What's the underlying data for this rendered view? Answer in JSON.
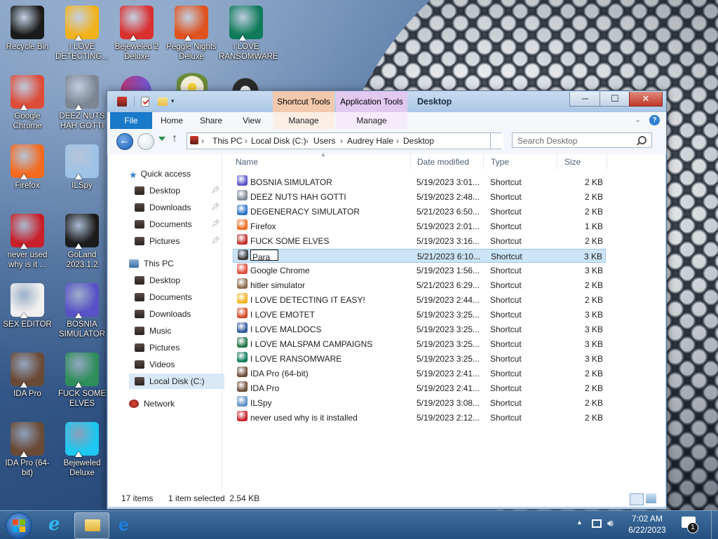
{
  "desktop": {
    "icons": [
      {
        "label": "Recycle Bin",
        "icon": "recycle-bin-icon",
        "color": "#1a1a1a"
      },
      {
        "label": "I LOVE DETECTING...",
        "icon": "die-icon",
        "color": "#f2b21c"
      },
      {
        "label": "Bejeweled 2 Deluxe",
        "icon": "bejeweled-2-icon",
        "color": "#d93030"
      },
      {
        "label": "Peggle Nights Deluxe",
        "icon": "peggle-icon",
        "color": "#e0531f"
      },
      {
        "label": "I LOVE RANSOMWARE",
        "icon": "publisher-icon",
        "color": "#0f7b5a"
      },
      {
        "label": "Google Chrome",
        "icon": "chrome-icon",
        "color": "#dd4b39"
      },
      {
        "label": "DEEZ NUTS HAH GOTTI",
        "icon": "stacked-windows-icon",
        "color": "#7d8794"
      },
      {
        "label": "Firefox",
        "icon": "firefox-icon",
        "color": "#f46a1e"
      },
      {
        "label": "ILSpy",
        "icon": "ilspy-icon",
        "color": "#9fc3e6"
      },
      {
        "label": "never used why is it ...",
        "icon": "devcpp-icon",
        "color": "#c8202a"
      },
      {
        "label": "GoLand 2023.1.2",
        "icon": "goland-icon",
        "color": "#1c1c1c"
      },
      {
        "label": "SEX EDITOR",
        "icon": "hxd-icon",
        "color": "#f0f0f0"
      },
      {
        "label": "BOSNIA SIMULATOR",
        "icon": "spiked-ball-icon",
        "color": "#5a53c8"
      },
      {
        "label": "IDA Pro",
        "icon": "ida-portrait-icon",
        "color": "#6b4a35"
      },
      {
        "label": "FUCK SOME ELVES",
        "icon": "santa-icon",
        "color": "#2f8f5a"
      },
      {
        "label": "IDA Pro (64-bit)",
        "icon": "ida64-portrait-icon",
        "color": "#6b4a35"
      },
      {
        "label": "Bejeweled Deluxe",
        "icon": "diamond-icon",
        "color": "#1ec8f0"
      }
    ],
    "partial_icons": [
      {
        "icon": "chrome-partial-icon",
        "color": "#c8447a"
      },
      {
        "icon": "flower-partial-icon",
        "color": "#e9e1c6"
      },
      {
        "icon": "gear-partial-icon",
        "color": "#2b2b2b"
      }
    ]
  },
  "window": {
    "title": "Desktop",
    "context_tabs": [
      {
        "label": "Shortcut Tools",
        "color": "#f3c9ae"
      },
      {
        "label": "Application Tools",
        "color": "#e1c9f0"
      }
    ],
    "ribbon_tabs": [
      "File",
      "Home",
      "Share",
      "View",
      "Manage",
      "Manage"
    ],
    "controls": {
      "minimize": "─",
      "maximize": "☐",
      "close": "✕"
    },
    "breadcrumbs": [
      "This PC",
      "Local Disk (C:)",
      "Users",
      "Audrey Hale",
      "Desktop"
    ],
    "search_placeholder": "Search Desktop",
    "nav_pane": {
      "quick_access": {
        "label": "Quick access",
        "items": [
          "Desktop",
          "Downloads",
          "Documents",
          "Pictures"
        ]
      },
      "this_pc": {
        "label": "This PC",
        "items": [
          "Desktop",
          "Documents",
          "Downloads",
          "Music",
          "Pictures",
          "Videos",
          "Local Disk (C:)"
        ]
      },
      "network": {
        "label": "Network"
      }
    },
    "columns": [
      "Name",
      "Date modified",
      "Type",
      "Size"
    ],
    "files": [
      {
        "name": "BOSNIA SIMULATOR",
        "date": "5/19/2023 3:01...",
        "type": "Shortcut",
        "size": "2 KB",
        "color": "#5a53c8"
      },
      {
        "name": "DEEZ NUTS HAH GOTTI",
        "date": "5/19/2023 2:48...",
        "type": "Shortcut",
        "size": "2 KB",
        "color": "#7d8794"
      },
      {
        "name": "DEGENERACY SIMULATOR",
        "date": "5/21/2023 6:50...",
        "type": "Shortcut",
        "size": "2 KB",
        "color": "#2a73c7"
      },
      {
        "name": "Firefox",
        "date": "5/19/2023 2:01...",
        "type": "Shortcut",
        "size": "1 KB",
        "color": "#f46a1e"
      },
      {
        "name": "FUCK SOME ELVES",
        "date": "5/19/2023 3:16...",
        "type": "Shortcut",
        "size": "2 KB",
        "color": "#c0302a"
      },
      {
        "name": "Para",
        "date": "5/21/2023 6:10...",
        "type": "Shortcut",
        "size": "3 KB",
        "color": "#3a3a3a",
        "selected": true
      },
      {
        "name": "Google Chrome",
        "date": "5/19/2023 1:56...",
        "type": "Shortcut",
        "size": "3 KB",
        "color": "#dd4b39"
      },
      {
        "name": "hitler simulator",
        "date": "5/21/2023 6:29...",
        "type": "Shortcut",
        "size": "2 KB",
        "color": "#8a6a4a"
      },
      {
        "name": "I LOVE DETECTING IT EASY!",
        "date": "5/19/2023 2:44...",
        "type": "Shortcut",
        "size": "2 KB",
        "color": "#f2b21c"
      },
      {
        "name": "I LOVE EMOTET",
        "date": "5/19/2023 3:25...",
        "type": "Shortcut",
        "size": "3 KB",
        "color": "#d24726"
      },
      {
        "name": "I LOVE MALDOCS",
        "date": "5/19/2023 3:25...",
        "type": "Shortcut",
        "size": "3 KB",
        "color": "#2b579a"
      },
      {
        "name": "I LOVE MALSPAM CAMPAIGNS",
        "date": "5/19/2023 3:25...",
        "type": "Shortcut",
        "size": "3 KB",
        "color": "#217346"
      },
      {
        "name": "I LOVE RANSOMWARE",
        "date": "5/19/2023 3:25...",
        "type": "Shortcut",
        "size": "3 KB",
        "color": "#0f7b5a"
      },
      {
        "name": "IDA Pro (64-bit)",
        "date": "5/19/2023 2:41...",
        "type": "Shortcut",
        "size": "2 KB",
        "color": "#6b4a35"
      },
      {
        "name": "IDA Pro",
        "date": "5/19/2023 2:41...",
        "type": "Shortcut",
        "size": "2 KB",
        "color": "#6b4a35"
      },
      {
        "name": "ILSpy",
        "date": "5/19/2023 3:08...",
        "type": "Shortcut",
        "size": "2 KB",
        "color": "#5b8fc8"
      },
      {
        "name": "never used why is it installed",
        "date": "5/19/2023 2:12...",
        "type": "Shortcut",
        "size": "2 KB",
        "color": "#c8202a"
      }
    ],
    "status": {
      "count": "17 items",
      "selection": "1 item selected  2.54 KB"
    }
  },
  "taskbar": {
    "clock_time": "7:02 AM",
    "clock_date": "6/22/2023",
    "notification_count": "1"
  }
}
